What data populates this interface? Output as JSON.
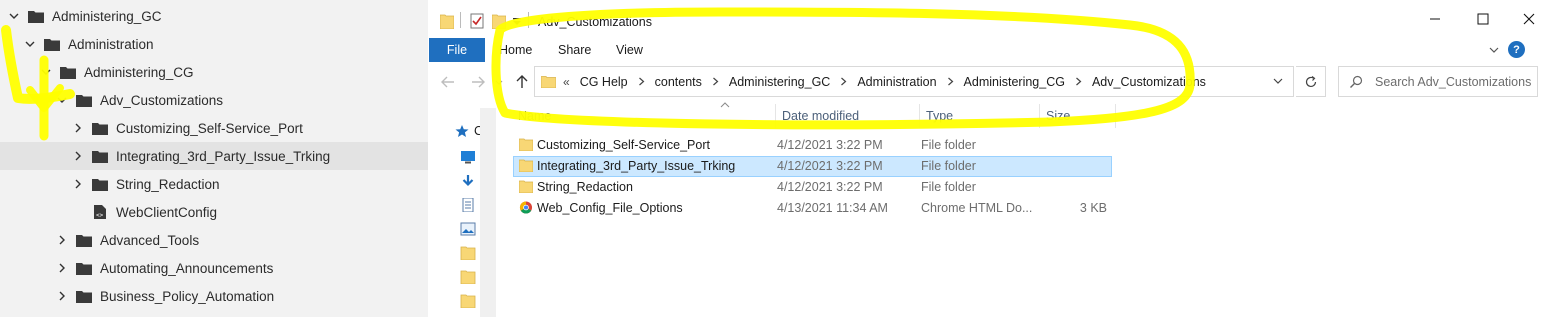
{
  "tree": {
    "items": [
      {
        "label": "Administering_GC",
        "level": 0,
        "expanded": true,
        "icon": "folder-icon"
      },
      {
        "label": "Administration",
        "level": 1,
        "expanded": true,
        "icon": "folder-icon"
      },
      {
        "label": "Administering_CG",
        "level": 2,
        "expanded": true,
        "icon": "folder-icon"
      },
      {
        "label": "Adv_Customizations",
        "level": 3,
        "expanded": true,
        "icon": "folder-icon"
      },
      {
        "label": "Customizing_Self-Service_Port",
        "level": 4,
        "expanded": false,
        "icon": "folder-icon"
      },
      {
        "label": "Integrating_3rd_Party_Issue_Trking",
        "level": 4,
        "expanded": false,
        "icon": "folder-icon",
        "selected": true
      },
      {
        "label": "String_Redaction",
        "level": 4,
        "expanded": false,
        "icon": "folder-icon"
      },
      {
        "label": "WebClientConfig",
        "level": 4,
        "expanded": null,
        "icon": "html-file-icon"
      },
      {
        "label": "Advanced_Tools",
        "level": 3,
        "expanded": false,
        "icon": "folder-icon"
      },
      {
        "label": "Automating_Announcements",
        "level": 3,
        "expanded": false,
        "icon": "folder-icon"
      },
      {
        "label": "Business_Policy_Automation",
        "level": 3,
        "expanded": false,
        "icon": "folder-icon"
      }
    ]
  },
  "explorer": {
    "title": "Adv_Customizations",
    "ribbon": {
      "file": "File",
      "tabs": [
        "Home",
        "Share",
        "View"
      ]
    },
    "address": {
      "lead": "«",
      "crumbs": [
        "CG Help",
        "contents",
        "Administering_GC",
        "Administration",
        "Administering_CG",
        "Adv_Customizations"
      ]
    },
    "search": {
      "placeholder": "Search Adv_Customizations"
    },
    "nav_pane_label": "C",
    "columns": [
      "Name",
      "Date modified",
      "Type",
      "Size"
    ],
    "files": [
      {
        "name": "Customizing_Self-Service_Port",
        "date": "4/12/2021 3:22 PM",
        "type": "File folder",
        "size": "",
        "icon": "folder-icon",
        "selected": false
      },
      {
        "name": "Integrating_3rd_Party_Issue_Trking",
        "date": "4/12/2021 3:22 PM",
        "type": "File folder",
        "size": "",
        "icon": "folder-icon",
        "selected": true
      },
      {
        "name": "String_Redaction",
        "date": "4/12/2021 3:22 PM",
        "type": "File folder",
        "size": "",
        "icon": "folder-icon",
        "selected": false
      },
      {
        "name": "Web_Config_File_Options",
        "date": "4/13/2021 11:34 AM",
        "type": "Chrome HTML Do...",
        "size": "3 KB",
        "icon": "chrome-icon",
        "selected": false
      }
    ]
  },
  "colors": {
    "tree_bg": "#f2f2f2",
    "tree_selected": "#e3e3e3",
    "file_tab": "#1f6fbf",
    "row_selected": "#cce8ff",
    "highlighter": "#ffff00"
  }
}
